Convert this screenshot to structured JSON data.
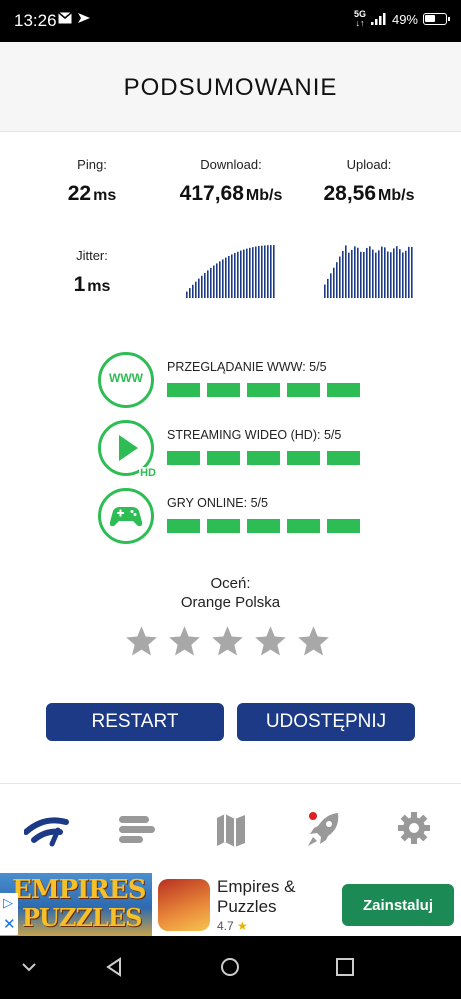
{
  "status_bar": {
    "time": "13:26",
    "network": "5G",
    "battery": "49%"
  },
  "header": {
    "title": "PODSUMOWANIE"
  },
  "results": {
    "ping": {
      "label": "Ping:",
      "value": "22",
      "unit": "ms"
    },
    "download": {
      "label": "Download:",
      "value": "417,68",
      "unit": "Mb/s"
    },
    "upload": {
      "label": "Upload:",
      "value": "28,56",
      "unit": "Mb/s"
    },
    "jitter": {
      "label": "Jitter:",
      "value": "1",
      "unit": "ms"
    }
  },
  "quality": [
    {
      "label": "PRZEGLĄDANIE WWW: 5/5",
      "icon": "www-icon",
      "score": 5,
      "max": 5
    },
    {
      "label": "STREAMING WIDEO (HD): 5/5",
      "icon": "play-hd-icon",
      "icon_badge": "HD",
      "score": 5,
      "max": 5
    },
    {
      "label": "GRY ONLINE: 5/5",
      "icon": "gamepad-icon",
      "score": 5,
      "max": 5
    }
  ],
  "www_icon_text": "WWW",
  "rating": {
    "title": "Oceń:",
    "isp": "Orange Polska",
    "stars_total": 5,
    "stars_filled": 0
  },
  "buttons": {
    "restart": "RESTART",
    "share": "UDOSTĘPNIJ"
  },
  "nav": [
    "speedtest-icon",
    "results-list-icon",
    "map-icon",
    "rocket-icon",
    "settings-icon"
  ],
  "ad": {
    "banner_line1": "EMPIRES",
    "banner_line2": "PUZZLES",
    "app_name": "Empires & Puzzles",
    "rating": "4.7",
    "install": "Zainstaluj"
  },
  "colors": {
    "accent_green": "#2ebd55",
    "button_blue": "#1c3a86",
    "chart_navy": "#1c3a86",
    "install_green": "#1c8a55"
  }
}
